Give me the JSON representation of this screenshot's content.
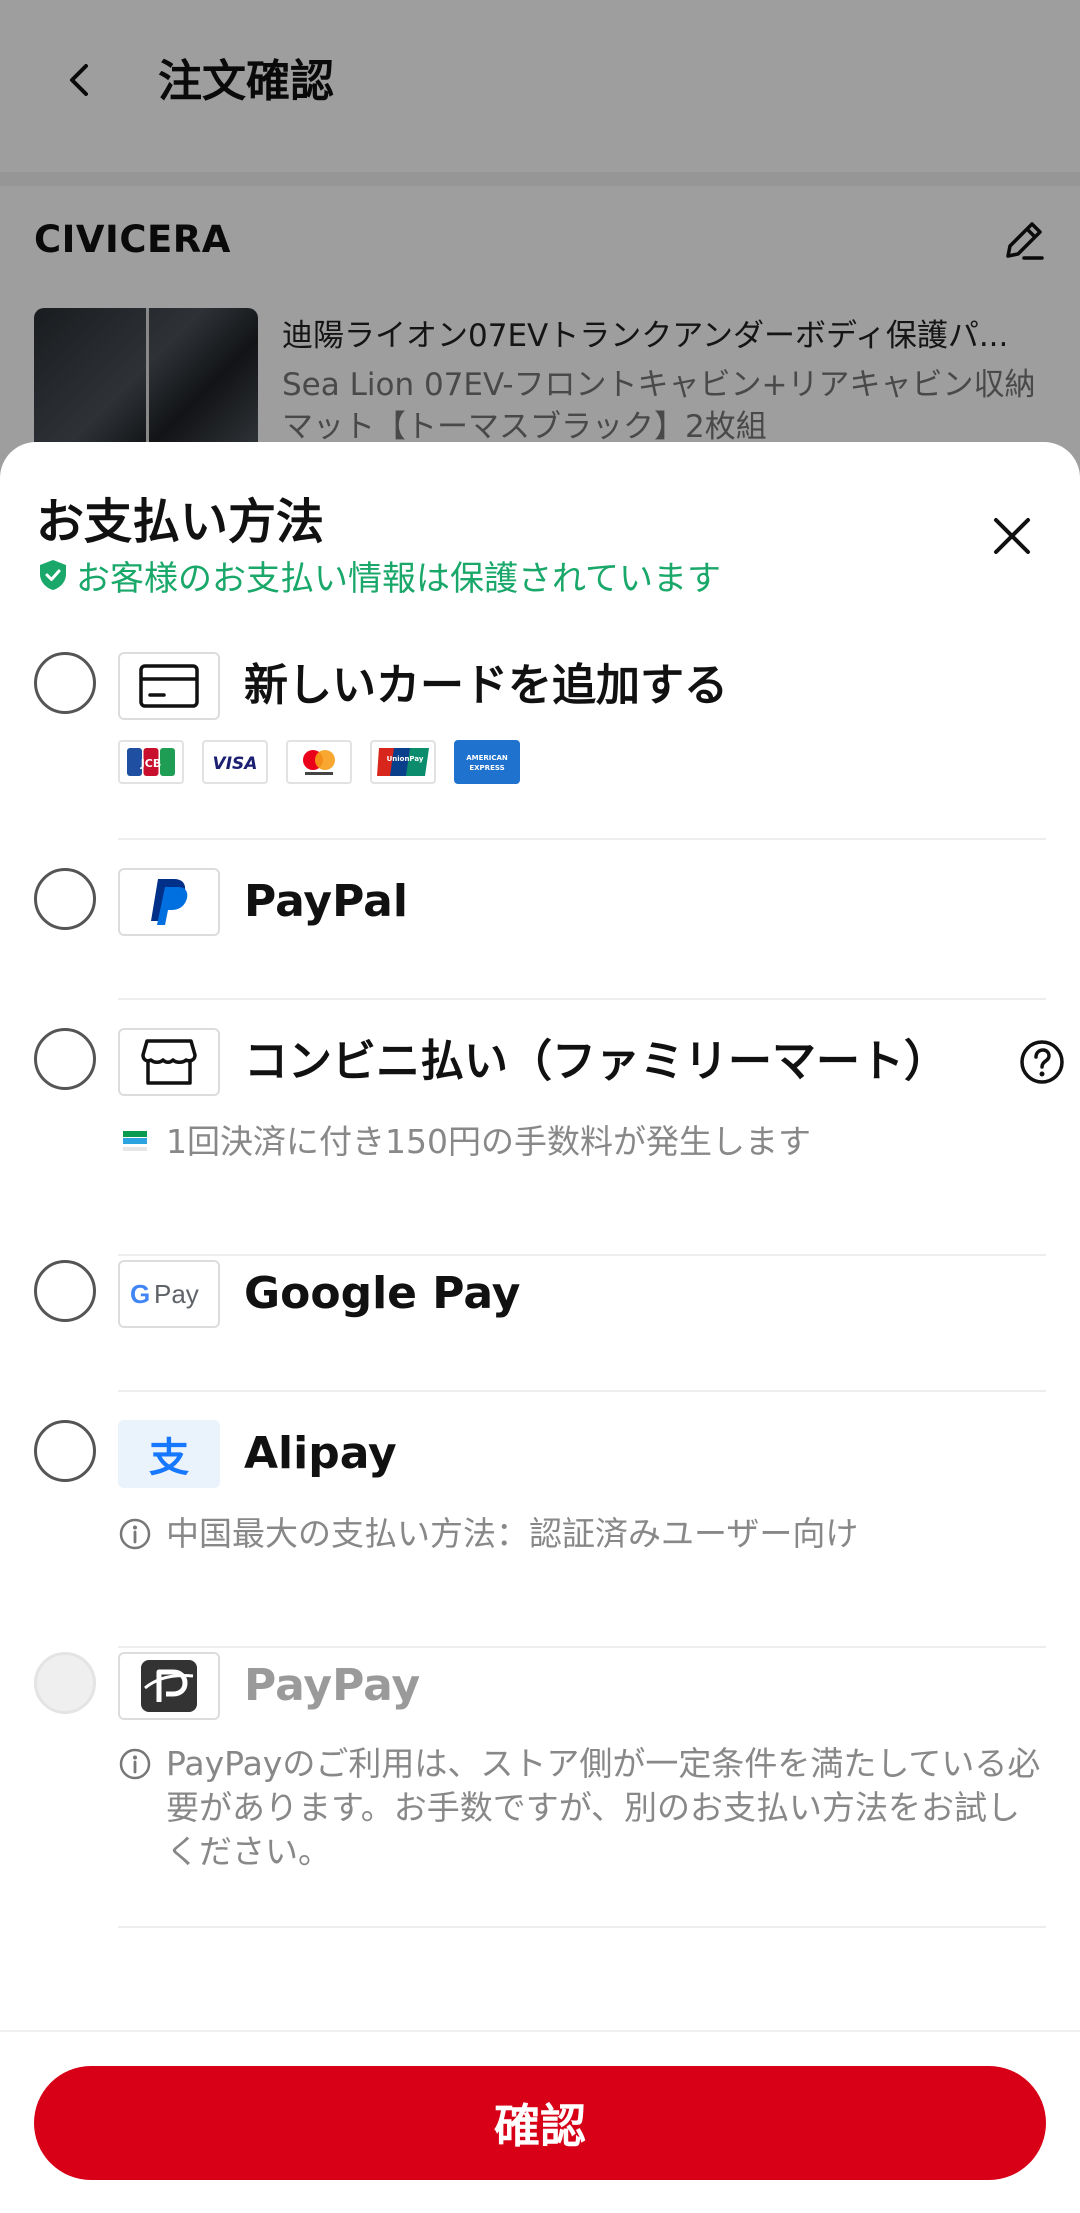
{
  "header": {
    "title": "注文確認",
    "back_icon": "chevron-left-icon"
  },
  "store": {
    "name": "CIVICERA",
    "edit_icon": "pencil-icon",
    "product": {
      "title": "迪陽ライオン07EVトランクアンダーボディ保護パ...",
      "variant": "Sea Lion 07EV-フロントキャビン+リアキャビン収納マット【トーマスブラック】2枚組"
    }
  },
  "payment_sheet": {
    "title": "お支払い方法",
    "secure_text": "お客様のお支払い情報は保護されています",
    "close_icon": "close-icon",
    "methods": [
      {
        "label": "新しいカードを追加する",
        "icon": "credit-card-icon",
        "brands": [
          "JCB",
          "VISA",
          "Mastercard",
          "UnionPay",
          "AMERICAN EXPRESS"
        ]
      },
      {
        "label": "PayPal",
        "icon": "paypal-icon"
      },
      {
        "label": "コンビニ払い（ファミリーマート）",
        "icon": "store-icon",
        "note": "1回決済に付き150円の手数料が発生します",
        "help_icon": "question-icon"
      },
      {
        "label": "Google Pay",
        "icon": "google-pay-icon",
        "icon_text": "G Pay"
      },
      {
        "label": "Alipay",
        "icon": "alipay-icon",
        "icon_text": "支",
        "note": "中国最大の支払い方法：認証済みユーザー向け"
      },
      {
        "label": "PayPay",
        "icon": "paypay-icon",
        "disabled": true,
        "note": "PayPayのご利用は、ストア側が一定条件を満たしている必要があります。お手数ですが、別のお支払い方法をお試しください。"
      }
    ],
    "confirm_label": "確認"
  },
  "colors": {
    "accent_red": "#d70016",
    "secure_green": "#1aa86a",
    "paypal_blue": "#0070e0"
  }
}
